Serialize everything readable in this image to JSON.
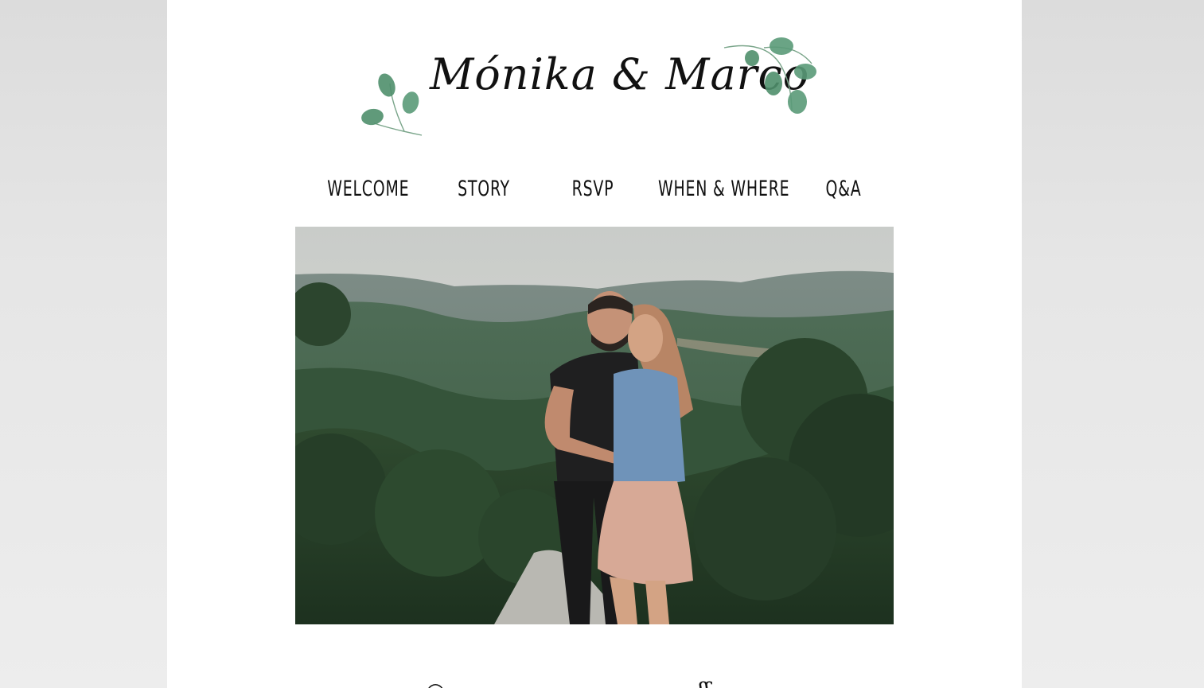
{
  "header": {
    "title": "Mónika & Marco"
  },
  "nav": {
    "items": [
      {
        "label": "WELCOME"
      },
      {
        "label": "STORY"
      },
      {
        "label": "RSVP"
      },
      {
        "label": "WHEN & WHERE"
      },
      {
        "label": "Q&A"
      }
    ]
  },
  "colors": {
    "background": "#e3e3e3",
    "page": "#ffffff",
    "text": "#111111",
    "leaf": "#5a9a78"
  }
}
